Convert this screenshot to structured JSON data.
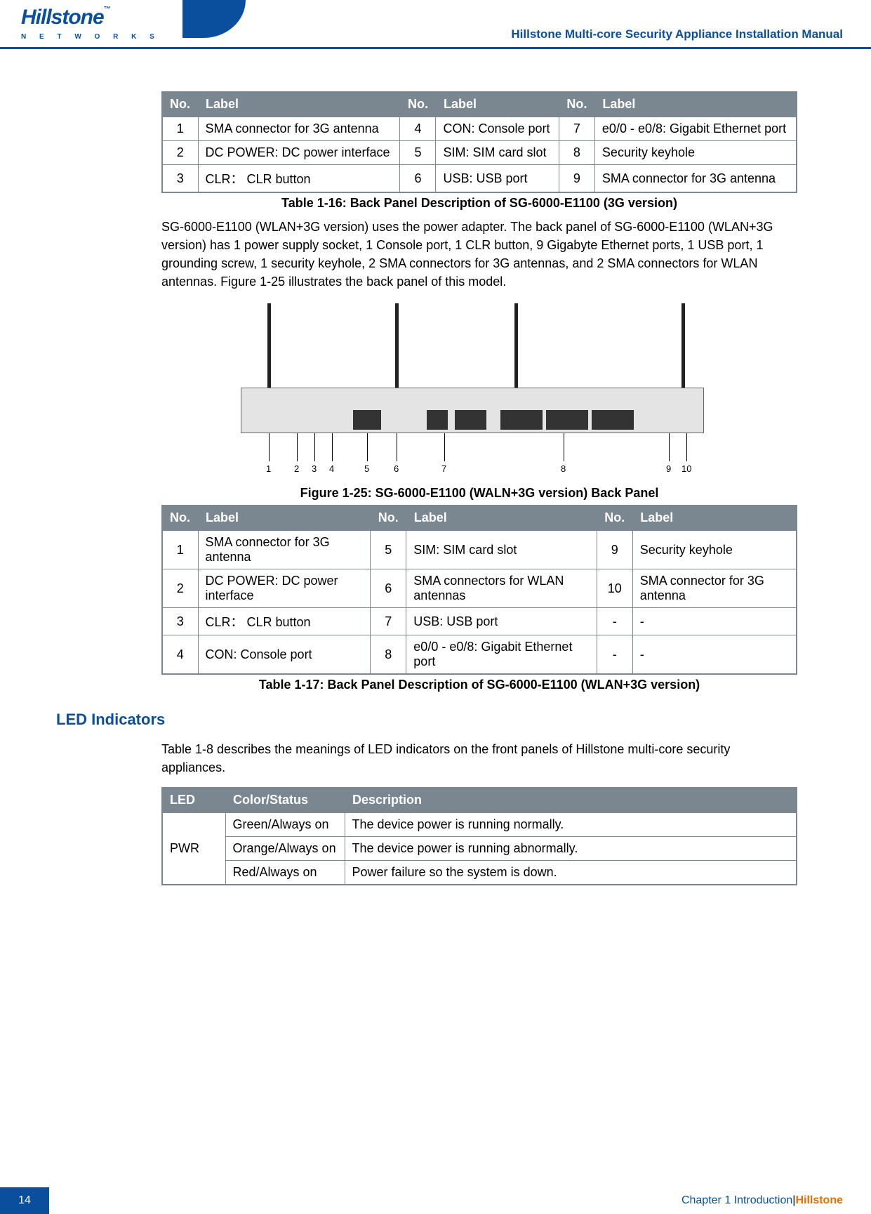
{
  "header": {
    "brand": "Hillstone",
    "sub": "N E T W O R K S",
    "title": "Hillstone Multi-core Security Appliance Installation Manual"
  },
  "table16": {
    "h_no": "No.",
    "h_label": "Label",
    "rows": [
      {
        "n1": "1",
        "l1": "SMA connector for 3G antenna",
        "n2": "4",
        "l2": "CON: Console port",
        "n3": "7",
        "l3": "e0/0 - e0/8: Gigabit Ethernet port"
      },
      {
        "n1": "2",
        "l1": "DC POWER: DC power interface",
        "n2": "5",
        "l2": "SIM: SIM card slot",
        "n3": "8",
        "l3": "Security keyhole"
      },
      {
        "n1": "3",
        "l1": "CLR： CLR button",
        "n2": "6",
        "l2": "USB: USB port",
        "n3": "9",
        "l3": "SMA connector for 3G antenna"
      }
    ],
    "caption": "Table 1-16: Back Panel Description of SG-6000-E1100 (3G version)"
  },
  "para1": "SG-6000-E1100 (WLAN+3G version) uses the power adapter. The back panel of SG-6000-E1100 (WLAN+3G version) has 1 power supply socket, 1 Console port, 1 CLR button, 9 Gigabyte Ethernet ports, 1 USB port, 1 grounding screw, 1 security keyhole, 2 SMA connectors for 3G antennas, and 2 SMA connectors for WLAN antennas. Figure 1-25 illustrates the back panel of this model.",
  "figure": {
    "caption": "Figure 1-25: SG-6000-E1100 (WALN+3G version) Back Panel",
    "callouts": [
      "1",
      "2",
      "3",
      "4",
      "5",
      "6",
      "7",
      "8",
      "9",
      "10"
    ]
  },
  "table17": {
    "h_no": "No.",
    "h_label": "Label",
    "rows": [
      {
        "n1": "1",
        "l1": "SMA connector for 3G antenna",
        "n2": "5",
        "l2": "SIM: SIM card slot",
        "n3": "9",
        "l3": "Security keyhole"
      },
      {
        "n1": "2",
        "l1": "DC POWER: DC power interface",
        "n2": "6",
        "l2": "SMA connectors for WLAN antennas",
        "n3": "10",
        "l3": "SMA connector for 3G antenna"
      },
      {
        "n1": "3",
        "l1": "CLR： CLR button",
        "n2": "7",
        "l2": "USB: USB port",
        "n3": "-",
        "l3": "-"
      },
      {
        "n1": "4",
        "l1": "CON: Console port",
        "n2": "8",
        "l2": "e0/0 - e0/8: Gigabit Ethernet port",
        "n3": "-",
        "l3": "-"
      }
    ],
    "caption": "Table 1-17: Back Panel Description of SG-6000-E1100 (WLAN+3G version)"
  },
  "section_heading": "LED Indicators",
  "para2": "Table 1-8 describes the meanings of LED indicators on the front panels of Hillstone multi-core security appliances.",
  "ledtable": {
    "h_led": "LED",
    "h_cs": "Color/Status",
    "h_desc": "Description",
    "led": "PWR",
    "rows": [
      {
        "cs": "Green/Always on",
        "d": "The device power is running normally."
      },
      {
        "cs": "Orange/Always on",
        "d": "The device power is running abnormally."
      },
      {
        "cs": "Red/Always on",
        "d": "Power failure so the system is down."
      }
    ]
  },
  "footer": {
    "page": "14",
    "chapter": "Chapter 1 Introduction",
    "sep": " | ",
    "brand": "Hillstone"
  }
}
